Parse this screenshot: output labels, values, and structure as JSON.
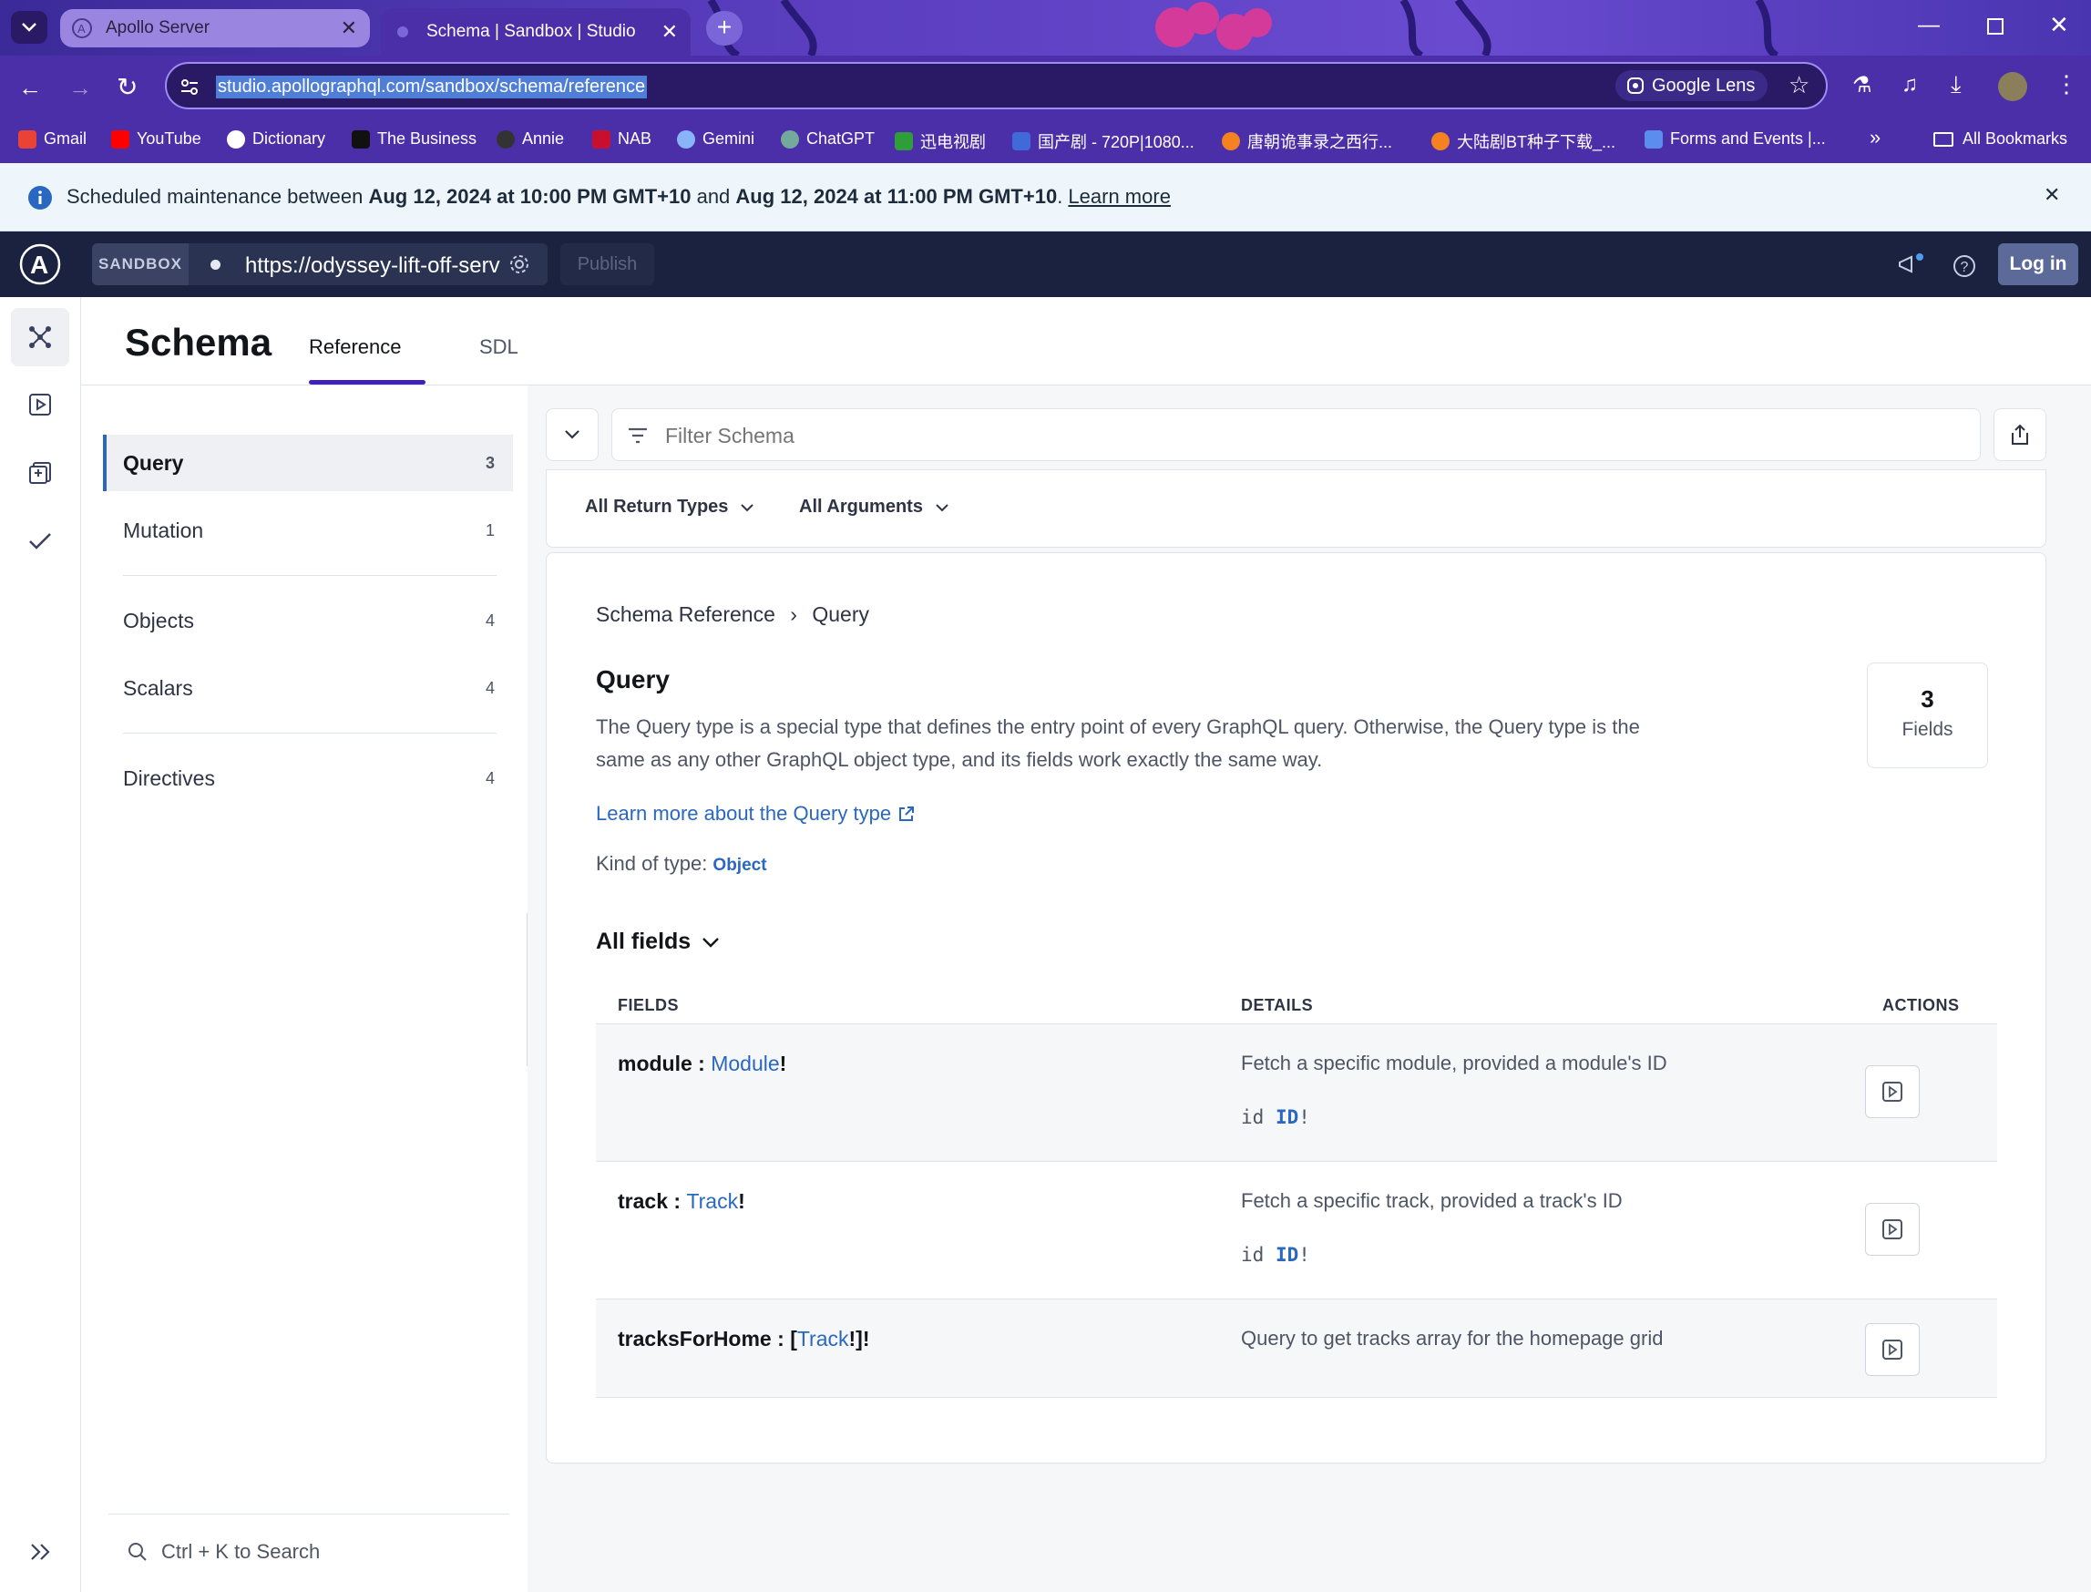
{
  "browser": {
    "tabs": [
      {
        "label": "Apollo Server"
      },
      {
        "label": "Schema | Sandbox | Studio"
      }
    ],
    "url": "studio.apollographql.com/sandbox/schema/reference",
    "lens_label": "Google Lens",
    "bookmarks": [
      {
        "label": "Gmail",
        "color": "#ea4335"
      },
      {
        "label": "YouTube",
        "color": "#ff0000"
      },
      {
        "label": "Dictionary",
        "color": "#4285f4"
      },
      {
        "label": "The Business",
        "color": "#111111"
      },
      {
        "label": "Annie",
        "color": "#333333"
      },
      {
        "label": "NAB",
        "color": "#c8102e"
      },
      {
        "label": "Gemini",
        "color": "#8ab4f8"
      },
      {
        "label": "ChatGPT",
        "color": "#74aa9c"
      },
      {
        "label": "迅电视剧",
        "color": "#2e9d3a"
      },
      {
        "label": "国产剧 - 720P|1080...",
        "color": "#3f6ad8"
      },
      {
        "label": "唐朝诡事录之西行...",
        "color": "#f58220"
      },
      {
        "label": "大陆剧BT种子下载_...",
        "color": "#f58220"
      },
      {
        "label": "Forms and Events |...",
        "color": "#5b8def"
      }
    ],
    "all_bookmarks_label": "All Bookmarks"
  },
  "banner": {
    "prefix": "Scheduled maintenance between ",
    "start": "Aug 12, 2024 at 10:00 PM GMT+10",
    "middle": " and ",
    "end": "Aug 12, 2024 at 11:00 PM GMT+10",
    "suffix": ". ",
    "link": "Learn more"
  },
  "header": {
    "sandbox_label": "SANDBOX",
    "endpoint": "https://odyssey-lift-off-serv",
    "publish_label": "Publish",
    "login_label": "Log in"
  },
  "page": {
    "title": "Schema",
    "tabs": [
      {
        "label": "Reference",
        "active": true
      },
      {
        "label": "SDL",
        "active": false
      }
    ]
  },
  "sidenav": {
    "items": [
      {
        "label": "Query",
        "count": "3"
      },
      {
        "label": "Mutation",
        "count": "1"
      },
      {
        "label": "Objects",
        "count": "4"
      },
      {
        "label": "Scalars",
        "count": "4"
      },
      {
        "label": "Directives",
        "count": "4"
      }
    ],
    "search_label": "Ctrl + K to Search"
  },
  "filter": {
    "placeholder": "Filter Schema",
    "return_types_label": "All Return Types",
    "arguments_label": "All Arguments"
  },
  "reference": {
    "breadcrumb_root": "Schema Reference",
    "breadcrumb_sep": "›",
    "breadcrumb_current": "Query",
    "type_name": "Query",
    "description_line1": "The Query type is a special type that defines the entry point of every GraphQL query. Otherwise, the Query type is the",
    "description_line2": "same as any other GraphQL object type, and its fields work exactly the same way.",
    "learn_more": "Learn more about the Query type",
    "kind_label": "Kind of type: ",
    "kind_value": "Object",
    "fields_count": "3",
    "fields_count_label": "Fields",
    "all_fields_label": "All fields",
    "columns": {
      "fields": "FIELDS",
      "details": "DETAILS",
      "actions": "ACTIONS"
    },
    "rows": [
      {
        "name": "module",
        "sep": " : ",
        "open": "",
        "type": "Module",
        "close": "!",
        "detail": "Fetch a specific module, provided a module's ID",
        "arg_name": "id",
        "arg_type": "ID",
        "arg_bang": "!"
      },
      {
        "name": "track",
        "sep": " : ",
        "open": "",
        "type": "Track",
        "close": "!",
        "detail": "Fetch a specific track, provided a track's ID",
        "arg_name": "id",
        "arg_type": "ID",
        "arg_bang": "!"
      },
      {
        "name": "tracksForHome",
        "sep": " : ",
        "open": "[",
        "type": "Track",
        "close": "!]!",
        "detail": "Query to get tracks array for the homepage grid"
      }
    ]
  },
  "colors": {
    "header_bg": "#1b2240",
    "accent": "#3f20ba",
    "link": "#2a67c0"
  }
}
